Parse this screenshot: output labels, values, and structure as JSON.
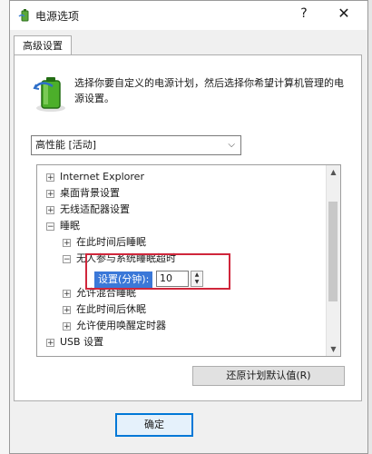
{
  "window": {
    "title": "电源选项",
    "help_glyph": "?",
    "close_glyph": "✕"
  },
  "tab": {
    "label": "高级设置"
  },
  "description": "选择你要自定义的电源计划，然后选择你希望计算机管理的电源设置。",
  "plan_select": {
    "value": "高性能 [活动]"
  },
  "tree": {
    "items": [
      {
        "label": "Internet Explorer",
        "expander": "⊞"
      },
      {
        "label": "桌面背景设置",
        "expander": "⊞"
      },
      {
        "label": "无线适配器设置",
        "expander": "⊞"
      },
      {
        "label": "睡眠",
        "expander": "⊟"
      },
      {
        "label": "在此时间后睡眠",
        "expander": "⊞"
      },
      {
        "label": "无人参与系统睡眠超时",
        "expander": "⊟"
      },
      {
        "label": "允许混合睡眠",
        "expander": "⊞"
      },
      {
        "label": "在此时间后休眠",
        "expander": "⊞"
      },
      {
        "label": "允许使用唤醒定时器",
        "expander": "⊞"
      },
      {
        "label": "USB 设置",
        "expander": "⊞"
      }
    ],
    "setting": {
      "label": "设置(分钟):",
      "value": "10"
    }
  },
  "restore_button": "还原计划默认值(R)",
  "ok_button": "确定",
  "colors": {
    "highlight_border": "#d0263b",
    "selection_bg": "#3b78d8",
    "ok_border": "#0078d7"
  }
}
